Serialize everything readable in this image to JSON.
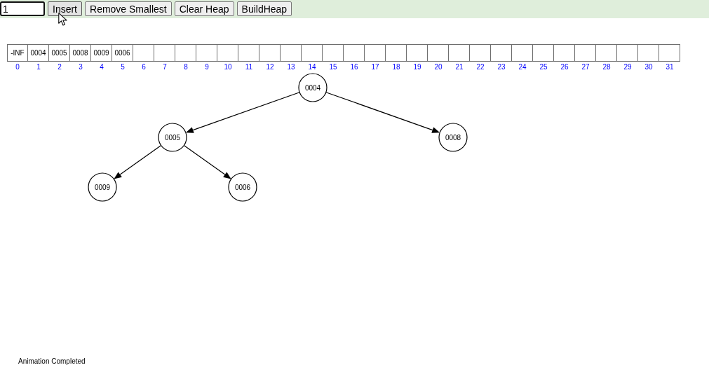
{
  "toolbar": {
    "input": {
      "value": "1"
    },
    "buttons": [
      {
        "label": "Insert",
        "hovered": true
      },
      {
        "label": "Remove Smallest",
        "hovered": false
      },
      {
        "label": "Clear Heap",
        "hovered": false
      },
      {
        "label": "BuildHeap",
        "hovered": false
      }
    ]
  },
  "heap_array": {
    "cells": [
      {
        "index": "0",
        "value": "-INF"
      },
      {
        "index": "1",
        "value": "0004"
      },
      {
        "index": "2",
        "value": "0005"
      },
      {
        "index": "3",
        "value": "0008"
      },
      {
        "index": "4",
        "value": "0009"
      },
      {
        "index": "5",
        "value": "0006"
      },
      {
        "index": "6"
      },
      {
        "index": "7"
      },
      {
        "index": "8"
      },
      {
        "index": "9"
      },
      {
        "index": "10"
      },
      {
        "index": "11"
      },
      {
        "index": "12"
      },
      {
        "index": "13"
      },
      {
        "index": "14"
      },
      {
        "index": "15"
      },
      {
        "index": "16"
      },
      {
        "index": "17"
      },
      {
        "index": "18"
      },
      {
        "index": "19"
      },
      {
        "index": "20"
      },
      {
        "index": "21"
      },
      {
        "index": "22"
      },
      {
        "index": "23"
      },
      {
        "index": "24"
      },
      {
        "index": "25"
      },
      {
        "index": "26"
      },
      {
        "index": "27"
      },
      {
        "index": "28"
      },
      {
        "index": "29"
      },
      {
        "index": "30"
      },
      {
        "index": "31"
      }
    ]
  },
  "tree": {
    "root": {
      "value": "0004",
      "children": [
        {
          "value": "0005",
          "children": [
            {
              "value": "0009"
            },
            {
              "value": "0006"
            }
          ]
        },
        {
          "value": "0008"
        }
      ]
    }
  },
  "status_bar": {
    "text": "Animation Completed"
  }
}
